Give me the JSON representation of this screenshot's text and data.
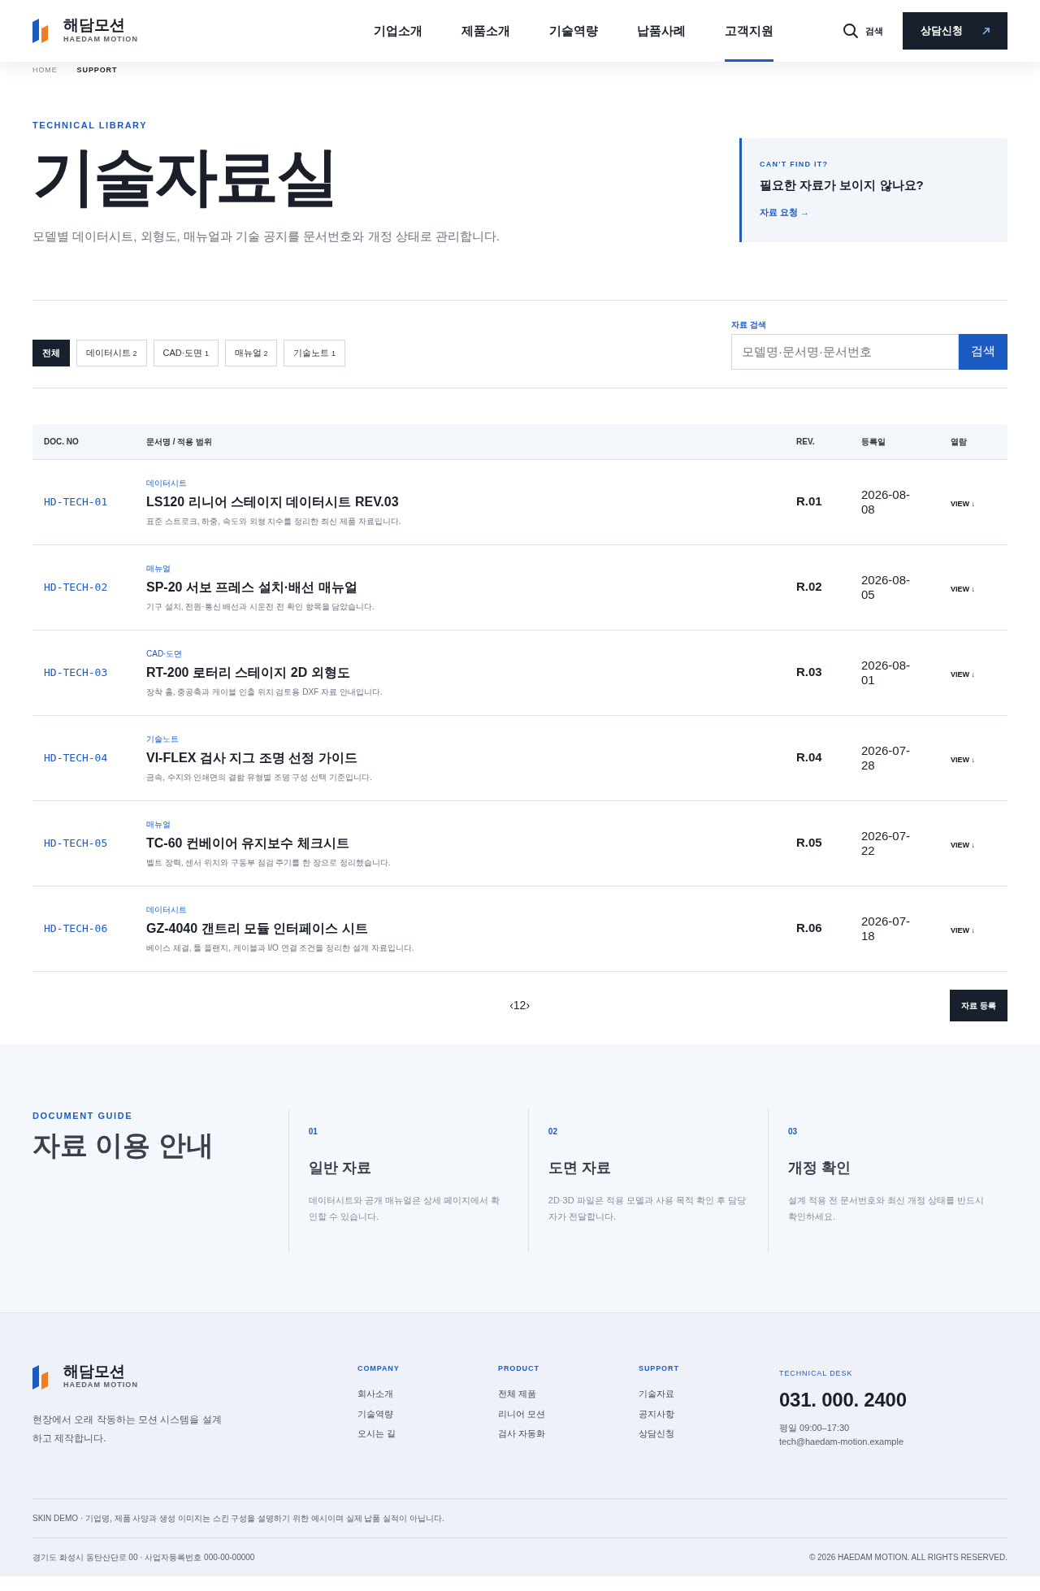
{
  "header": {
    "brand": {
      "name": "해담모션",
      "sub": "HAEDAM MOTION"
    },
    "nav": [
      {
        "label": "기업소개",
        "selected": false
      },
      {
        "label": "제품소개",
        "selected": false
      },
      {
        "label": "기술역량",
        "selected": false
      },
      {
        "label": "납품사례",
        "selected": false
      },
      {
        "label": "고객지원",
        "selected": true
      }
    ],
    "search_label": "검색",
    "cta": "상담신청"
  },
  "breadcrumb": [
    "HOME",
    "SUPPORT"
  ],
  "hero": {
    "eyebrow": "TECHNICAL LIBRARY",
    "title": "기술자료실",
    "description": "모델별 데이터시트, 외형도, 매뉴얼과 기술 공지를 문서번호와 개정 상태로 관리합니다.",
    "aside": {
      "eyebrow": "CAN'T FIND IT?",
      "title": "필요한 자료가 보이지 않나요?",
      "link": "자료 요청 →"
    }
  },
  "filters": [
    {
      "label": "전체",
      "selected": true
    },
    {
      "label": "데이터시트",
      "count": "2",
      "selected": false
    },
    {
      "label": "CAD·도면",
      "count": "1",
      "selected": false
    },
    {
      "label": "매뉴얼",
      "count": "2",
      "selected": false
    },
    {
      "label": "기술노트",
      "count": "1",
      "selected": false
    }
  ],
  "search": {
    "label": "자료 검색",
    "placeholder": "모델명·문서명·문서번호",
    "button": "검색"
  },
  "table": {
    "columns": [
      "DOC. NO",
      "문서명 / 적용 범위",
      "REV.",
      "등록일",
      "열람"
    ],
    "rows": [
      {
        "doc_no": "HD-TECH-01",
        "category": "데이터시트",
        "title": "LS120 리니어 스테이지 데이터시트 REV.03",
        "summary": "표준 스트로크, 하중, 속도와 외형 치수를 정리한 최신 제품 자료입니다.",
        "rev": "R.01",
        "date": "2026-08-08",
        "action": "VIEW ↓"
      },
      {
        "doc_no": "HD-TECH-02",
        "category": "매뉴얼",
        "title": "SP-20 서보 프레스 설치·배선 매뉴얼",
        "summary": "기구 설치, 전원·통신 배선과 시운전 전 확인 항목을 담았습니다.",
        "rev": "R.02",
        "date": "2026-08-05",
        "action": "VIEW ↓"
      },
      {
        "doc_no": "HD-TECH-03",
        "category": "CAD·도면",
        "title": "RT-200 로터리 스테이지 2D 외형도",
        "summary": "장착 홀, 중공축과 케이블 인출 위치 검토용 DXF 자료 안내입니다.",
        "rev": "R.03",
        "date": "2026-08-01",
        "action": "VIEW ↓"
      },
      {
        "doc_no": "HD-TECH-04",
        "category": "기술노트",
        "title": "VI-FLEX 검사 지그 조명 선정 가이드",
        "summary": "금속, 수지와 인쇄면의 결함 유형별 조명 구성 선택 기준입니다.",
        "rev": "R.04",
        "date": "2026-07-28",
        "action": "VIEW ↓"
      },
      {
        "doc_no": "HD-TECH-05",
        "category": "매뉴얼",
        "title": "TC-60 컨베이어 유지보수 체크시트",
        "summary": "벨트 장력, 센서 위치와 구동부 점검 주기를 한 장으로 정리했습니다.",
        "rev": "R.05",
        "date": "2026-07-22",
        "action": "VIEW ↓"
      },
      {
        "doc_no": "HD-TECH-06",
        "category": "데이터시트",
        "title": "GZ-4040 갠트리 모듈 인터페이스 시트",
        "summary": "베이스 체결, 툴 플랜지, 케이블과 I/O 연결 조건을 정리한 설계 자료입니다.",
        "rev": "R.06",
        "date": "2026-07-18",
        "action": "VIEW ↓"
      }
    ]
  },
  "pagination": [
    "‹",
    "1",
    "2",
    "›"
  ],
  "register_button": "자료 등록",
  "guide": {
    "eyebrow": "DOCUMENT GUIDE",
    "title": "자료 이용 안내",
    "items": [
      {
        "number": "01",
        "title": "일반 자료",
        "text": "데이터시트와 공개 매뉴얼은 상세 페이지에서 확인할 수 있습니다."
      },
      {
        "number": "02",
        "title": "도면 자료",
        "text": "2D·3D 파일은 적용 모델과 사용 목적 확인 후 담당자가 전달합니다."
      },
      {
        "number": "03",
        "title": "개정 확인",
        "text": "설계 적용 전 문서번호와 최신 개정 상태를 반드시 확인하세요."
      }
    ]
  },
  "footer": {
    "brand": {
      "name": "해담모션",
      "sub": "HAEDAM MOTION"
    },
    "tagline": "현장에서 오래 작동하는 모션 시스템을 설계하고 제작합니다.",
    "columns": [
      {
        "heading": "COMPANY",
        "links": [
          "회사소개",
          "기술역량",
          "오시는 길"
        ]
      },
      {
        "heading": "PRODUCT",
        "links": [
          "전체 제품",
          "리니어 모션",
          "검사 자동화"
        ]
      },
      {
        "heading": "SUPPORT",
        "links": [
          "기술자료",
          "공지사항",
          "상담신청"
        ]
      }
    ],
    "desk": {
      "heading": "TECHNICAL DESK",
      "phone": "031. 000. 2400",
      "hours": "평일 09:00–17:30",
      "email": "tech@haedam-motion.example"
    },
    "notice": "SKIN DEMO · 기업명, 제품 사양과 생성 이미지는 스킨 구성을 설명하기 위한 예시이며 실제 납품 실적이 아닙니다.",
    "address": "경기도 화성시 동탄산단로 00 · 사업자등록번호 000-00-00000",
    "copyright": "© 2026 HAEDAM MOTION. ALL RIGHTS RESERVED."
  }
}
